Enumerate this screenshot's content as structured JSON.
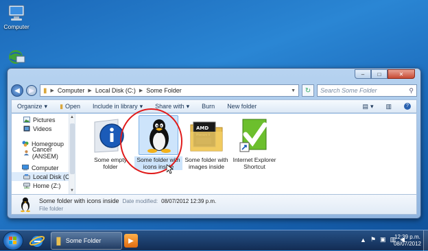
{
  "desktop": {
    "icons": [
      {
        "label": "Computer",
        "icon": "computer-icon"
      },
      {
        "label": "",
        "icon": "network-icon"
      }
    ]
  },
  "window": {
    "caption": {
      "minimize": "–",
      "maximize": "□",
      "close": "✕"
    },
    "address": {
      "crumbs": [
        "Computer",
        "Local Disk (C:)",
        "Some Folder"
      ]
    },
    "search_placeholder": "Search Some Folder",
    "toolbar": {
      "organize": "Organize",
      "open": "Open",
      "include_in_library": "Include in library",
      "share_with": "Share with",
      "burn": "Burn",
      "new_folder": "New folder"
    },
    "nav": {
      "items": [
        {
          "label": "Pictures",
          "icon": "pictures-icon"
        },
        {
          "label": "Videos",
          "icon": "videos-icon"
        },
        {
          "label": "Homegroup",
          "icon": "homegroup-icon"
        },
        {
          "label": "Cancer (ANSEM)",
          "icon": "user-icon"
        },
        {
          "label": "Computer",
          "icon": "computer-icon"
        },
        {
          "label": "Local Disk (C:)",
          "icon": "drive-icon"
        },
        {
          "label": "Home (Z:)",
          "icon": "network-drive-icon"
        }
      ]
    },
    "files": [
      {
        "label": "Some empty folder",
        "icon": "info-folder-icon"
      },
      {
        "label": "Some folder with icons inside",
        "icon": "tux-icon",
        "selected": true
      },
      {
        "label": "Some folder with images inside",
        "icon": "amd-folder-icon"
      },
      {
        "label": "Internet Explorer Shortcut",
        "icon": "checkmark-shortcut-icon"
      }
    ],
    "details": {
      "name": "Some folder with icons inside",
      "date_label": "Date modified:",
      "date_value": "08/07/2012 12:39 p.m.",
      "type": "File folder"
    }
  },
  "taskbar": {
    "window_button": "Some Folder",
    "clock_time": "12:39 p.m.",
    "clock_date": "08/07/2012"
  },
  "colors": {
    "highlight_circle": "#e01a1a",
    "selection": "#cde4fb"
  }
}
